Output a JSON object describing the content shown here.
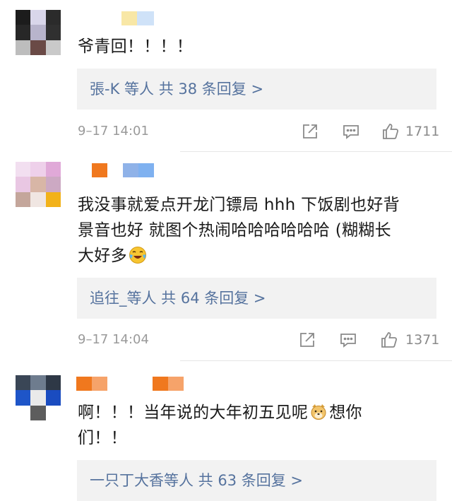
{
  "comments": [
    {
      "text": "爷青回！！！！",
      "reply_summary": "張-K 等人  共 38 条回复 >",
      "time": "9–17 14:01",
      "likes": "1711"
    },
    {
      "text_line1": "我没事就爱点开龙门镖局 hhh 下饭剧也好背",
      "text_line2": "景音也好  就图个热闹哈哈哈哈哈哈 (糊糊长",
      "text_line3": "大好多",
      "emoji": "laughing-crying-emoji",
      "reply_summary": "追往_等人  共 64 条回复 >",
      "time": "9–17 14:04",
      "likes": "1371"
    },
    {
      "text_line1": "啊！！！当年说的大年初五见呢",
      "text_line1_after": "想你",
      "text_line2": "们！！",
      "emoji": "doge-emoji",
      "reply_summary": "一只丁大香等人  共 63 条回复 >"
    }
  ],
  "icons": {
    "share": "share-icon",
    "comment": "comment-icon",
    "like": "thumbs-up-icon"
  },
  "colors": {
    "link": "#56739e",
    "reply_bg": "#f2f2f2",
    "meta_text": "#9a9a9a"
  }
}
